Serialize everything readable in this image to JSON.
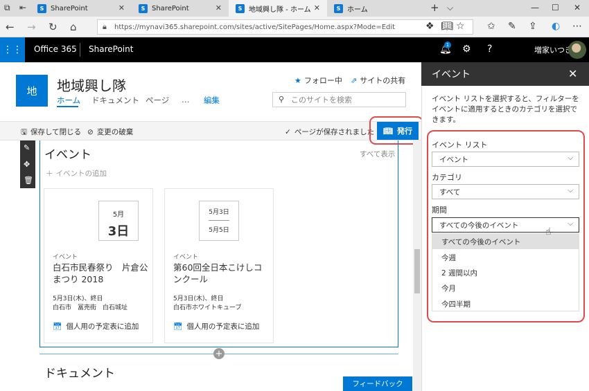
{
  "browser": {
    "tabs": [
      {
        "title": "SharePoint",
        "active": false
      },
      {
        "title": "SharePoint",
        "active": false
      },
      {
        "title": "地域興し隊 - ホーム",
        "active": true
      },
      {
        "title": "ホーム",
        "active": false
      }
    ],
    "new_tab": "+",
    "tab_menu": "⌵",
    "url": "https://mynavi365.sharepoint.com/sites/active/SitePages/Home.aspx?Mode=Edit"
  },
  "suite": {
    "app1": "Office 365",
    "app2": "SharePoint",
    "notif_count": "1",
    "help": "?",
    "user": "増家いつき"
  },
  "site": {
    "logo_text": "地",
    "title": "地域興し隊",
    "nav": [
      "ホーム",
      "ドキュメント",
      "ページ",
      "…",
      "編集"
    ],
    "follow_label": "フォロー中",
    "share_label": "サイトの共有",
    "search_placeholder": "このサイトを検索"
  },
  "commands": {
    "save_close": "保存して閉じる",
    "discard": "変更の破棄",
    "saved_status": "ページが保存されました",
    "publish": "発行"
  },
  "events_section": {
    "title": "イベント",
    "see_all": "すべて表示",
    "add_event": "イベントの追加",
    "cards": [
      {
        "date_month": "5月",
        "date_day": "3日",
        "category": "イベント",
        "name": "白石市民春祭り　片倉公まつり 2018",
        "when": "5月3日(木)、終日",
        "where": "白石市　冨売街　白石城址",
        "add_calendar": "個人用の予定表に追加"
      },
      {
        "date_start": "5月3日",
        "date_end": "5月5日",
        "category": "イベント",
        "name": "第60回全日本こけしコンクール",
        "when": "5月3日(木)、終日",
        "where": "白石市ホワイトキューブ",
        "add_calendar": "個人用の予定表に追加"
      }
    ]
  },
  "documents_section": {
    "title": "ドキュメント"
  },
  "feedback": "フィードバック",
  "panel": {
    "title": "イベント",
    "description": "イベント リストを選択すると、フィルターをイベントに適用するときのカテゴリを選択できます。",
    "list_label": "イベント リスト",
    "list_value": "イベント",
    "category_label": "カテゴリ",
    "category_value": "すべて",
    "period_label": "期間",
    "period_value": "すべての今後のイベント",
    "period_options": [
      "すべての今後のイベント",
      "今週",
      "2 週間以内",
      "今月",
      "今四半期"
    ]
  },
  "colors": {
    "accent": "#0078d4",
    "highlight": "#e04a4a",
    "suitebar": "#000000"
  }
}
